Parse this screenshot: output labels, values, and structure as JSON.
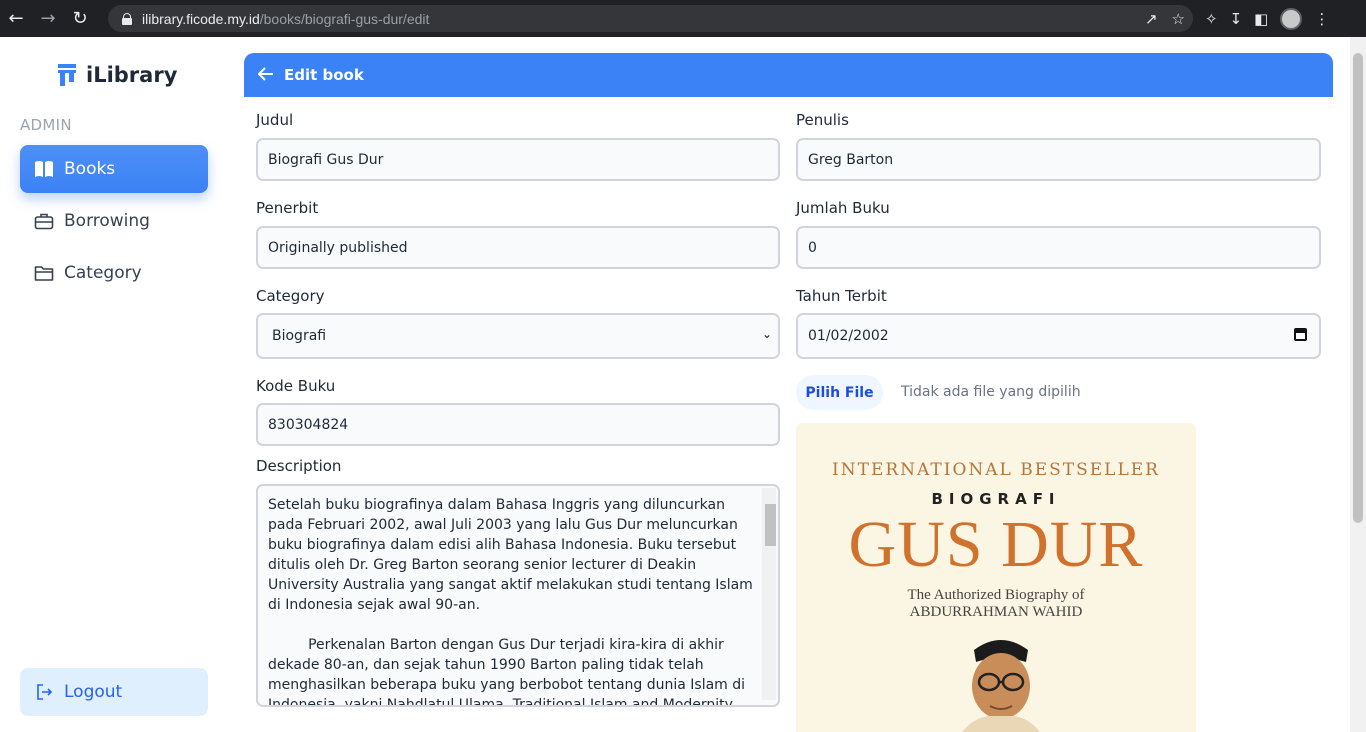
{
  "browser": {
    "url_host": "ilibrary.ficode.my.id",
    "url_path": "/books/biografi-gus-dur/edit"
  },
  "sidebar": {
    "brand": "iLibrary",
    "section": "ADMIN",
    "items": [
      {
        "label": "Books",
        "icon": "book-open-icon",
        "active": true
      },
      {
        "label": "Borrowing",
        "icon": "briefcase-icon",
        "active": false
      },
      {
        "label": "Category",
        "icon": "folder-icon",
        "active": false
      }
    ],
    "logout": "Logout"
  },
  "header": {
    "title": "Edit book"
  },
  "form": {
    "judul": {
      "label": "Judul",
      "value": "Biografi Gus Dur"
    },
    "penulis": {
      "label": "Penulis",
      "value": "Greg Barton"
    },
    "penerbit": {
      "label": "Penerbit",
      "value": "Originally published"
    },
    "jumlah_buku": {
      "label": "Jumlah Buku",
      "value": "0"
    },
    "category": {
      "label": "Category",
      "value": "Biografi"
    },
    "tahun_terbit": {
      "label": "Tahun Terbit",
      "value": "01/02/2002"
    },
    "kode_buku": {
      "label": "Kode Buku",
      "value": "830304824"
    },
    "file": {
      "button": "Pilih File",
      "status": "Tidak ada file yang dipilih"
    },
    "description": {
      "label": "Description",
      "value": "Setelah buku biografinya dalam Bahasa Inggris yang diluncurkan pada Februari 2002, awal Juli 2003 yang lalu Gus Dur meluncurkan buku biografinya dalam edisi alih Bahasa Indonesia. Buku tersebut ditulis oleh Dr. Greg Barton seorang senior lecturer di Deakin University Australia yang sangat aktif melakukan studi tentang Islam di Indonesia sejak awal 90-an.\n\n         Perkenalan Barton dengan Gus Dur terjadi kira-kira di akhir dekade 80-an, dan sejak tahun 1990 Barton paling tidak telah menghasilkan beberapa buku yang berbobot tentang dunia Islam di Indonesia, yakni Nahdlatul Ulama, Traditional Islam and Modernity"
    }
  },
  "cover": {
    "top_line": "INTERNATIONAL BESTSELLER",
    "kicker": "BIOGRAFI",
    "title": "GUS DUR",
    "subtitle_1": "The Authorized Biography of",
    "subtitle_2": "ABDURRAHMAN WAHID"
  }
}
